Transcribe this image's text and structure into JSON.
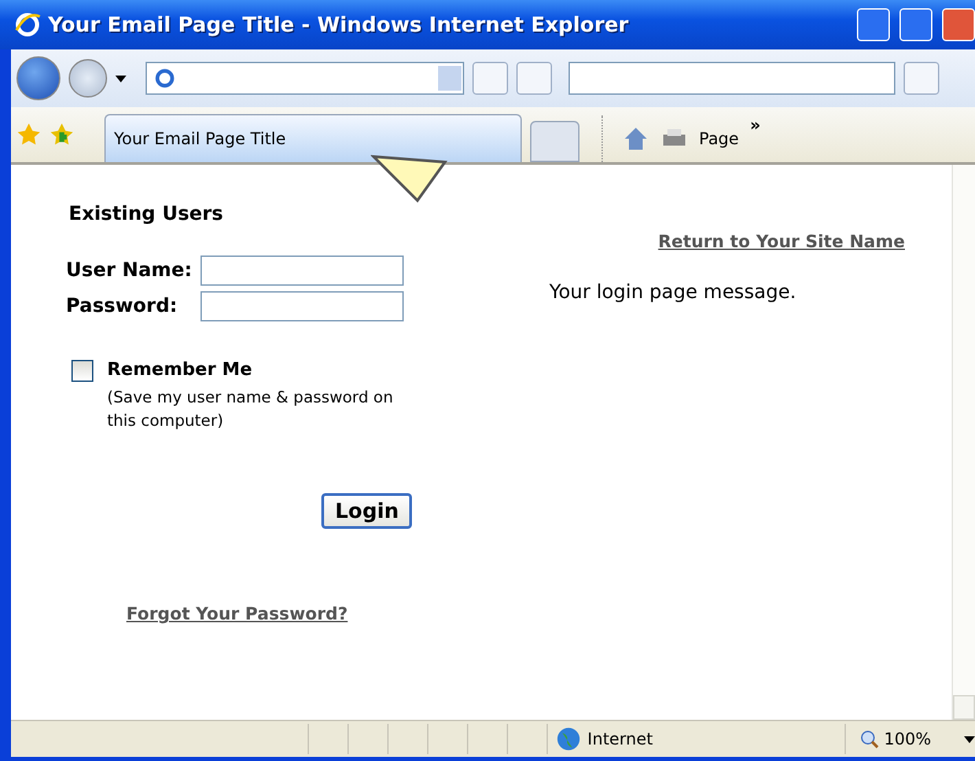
{
  "window": {
    "title": "Your Email Page Title - Windows Internet Explorer"
  },
  "tab": {
    "label": "Your Email Page Title",
    "selected": true
  },
  "toolbar": {
    "page_menu": "Page",
    "overflow": "»"
  },
  "page": {
    "heading": "Existing Users",
    "fields": [
      {
        "label": "User Name:"
      },
      {
        "label": "Password:"
      }
    ],
    "remember": {
      "label": "Remember Me",
      "checked": false,
      "note": "(Save my user name & password on this computer)"
    },
    "login_button": "Login",
    "forgot_link": "Forgot Your Password?",
    "return_link": "Return to Your Site Name",
    "message": "Your login page message."
  },
  "status_bar": {
    "zone": "Internet",
    "zoom": "100%"
  }
}
